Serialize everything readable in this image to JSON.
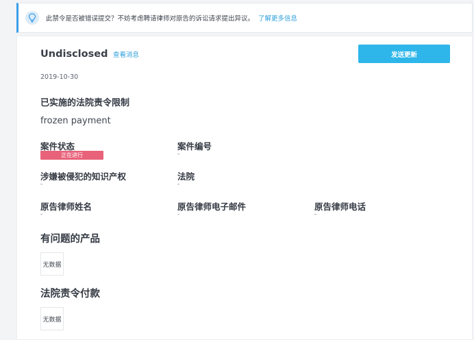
{
  "notice": {
    "icon": "lightbulb-icon",
    "message": "此禁令是否被错误提交？不妨考虑聘请律师对原告的诉讼请求提出异议。",
    "more_link": "了解更多信息"
  },
  "header": {
    "title": "Undisclosed",
    "view_messages": "查看消息",
    "send_update": "发送更新"
  },
  "date": "2019-10-30",
  "restriction": {
    "title": "已实施的法院责令限制",
    "value": "frozen payment"
  },
  "fields": {
    "case_status": {
      "label": "案件状态",
      "badge": "正在进行"
    },
    "case_number": {
      "label": "案件编号",
      "value": "-"
    },
    "ip_involved": {
      "label": "涉嫌被侵犯的知识产权",
      "value": "-"
    },
    "court": {
      "label": "法院",
      "value": "-"
    },
    "attorney_name": {
      "label": "原告律师姓名",
      "value": "-"
    },
    "attorney_email": {
      "label": "原告律师电子邮件",
      "value": "-"
    },
    "attorney_phone": {
      "label": "原告律师电话",
      "value": "-"
    }
  },
  "products": {
    "title": "有问题的产品",
    "empty": "无数据"
  },
  "payments": {
    "title": "法院责令付款",
    "empty": "无数据"
  },
  "colors": {
    "accent": "#2eb6ea",
    "link": "#2f9fdc",
    "badge": "#e8627a",
    "notice_border": "#3a9ee6"
  }
}
